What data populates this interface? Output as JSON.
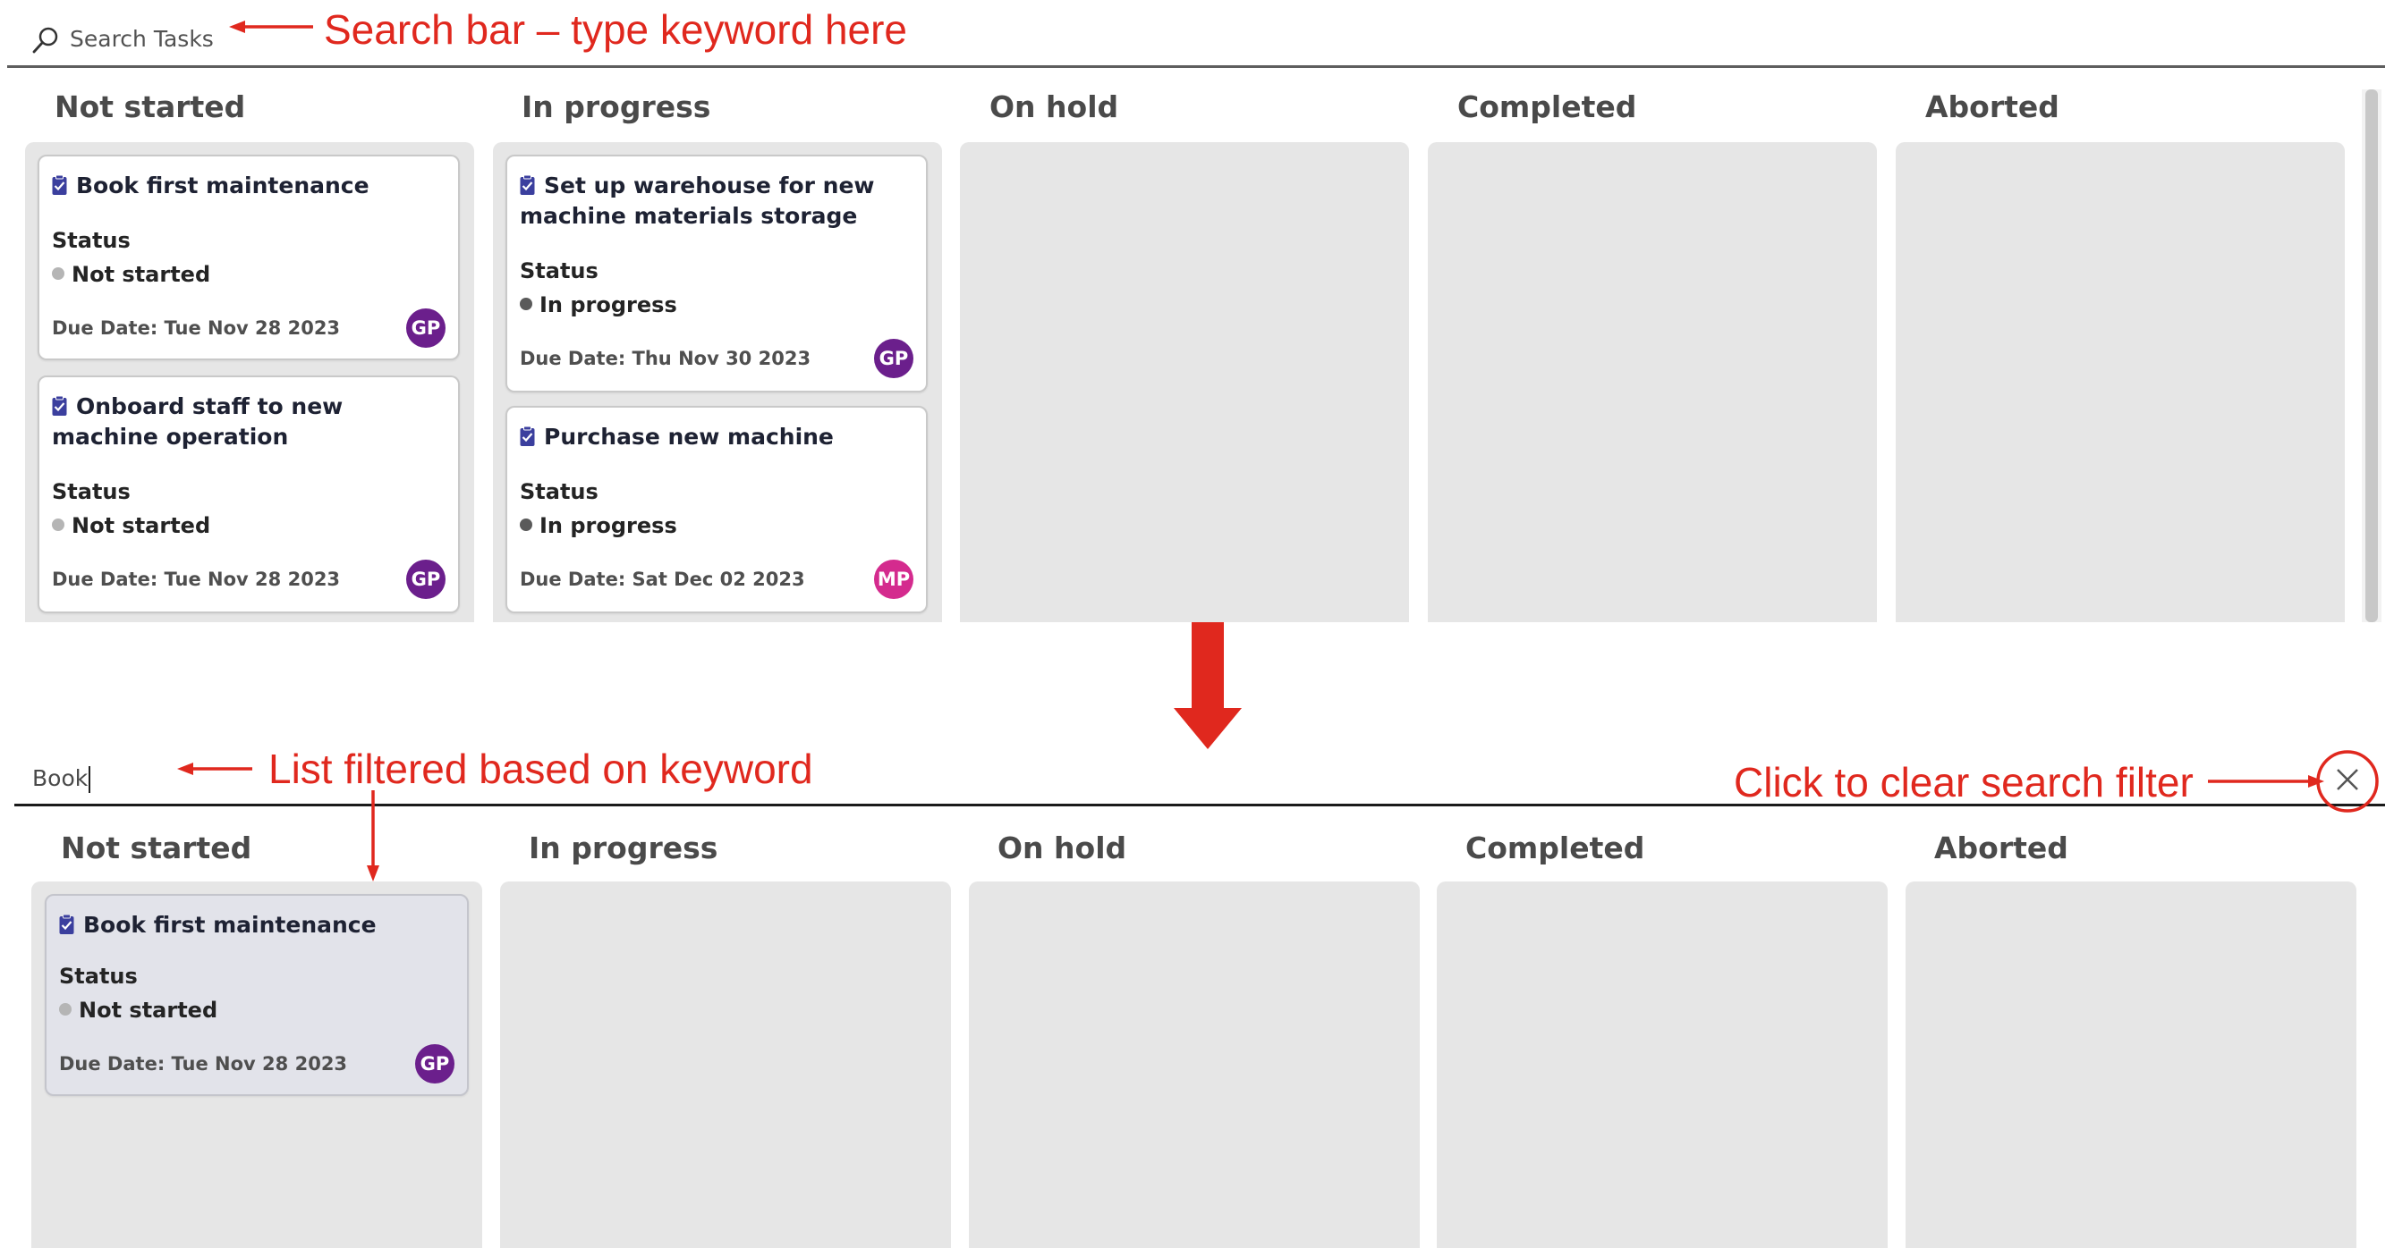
{
  "annotations": {
    "search_bar": "Search bar – type keyword here",
    "filtered": "List filtered based on keyword",
    "clear": "Click to clear search filter",
    "color": "#e0281e"
  },
  "top": {
    "search": {
      "placeholder": "Search Tasks",
      "icon": "search-icon"
    },
    "columns": [
      {
        "title": "Not started"
      },
      {
        "title": "In progress"
      },
      {
        "title": "On hold"
      },
      {
        "title": "Completed"
      },
      {
        "title": "Aborted"
      }
    ],
    "cards": [
      {
        "title": "Book first maintenance",
        "status_label": "Status",
        "status": "Not started",
        "due_label": "Due Date:",
        "due": "Tue Nov 28 2023",
        "assignee": "GP"
      },
      {
        "title": "Onboard staff to new machine operation",
        "status_label": "Status",
        "status": "Not started",
        "due_label": "Due Date:",
        "due": "Tue Nov 28 2023",
        "assignee": "GP"
      },
      {
        "title": "Set up warehouse for new machine materials storage",
        "status_label": "Status",
        "status": "In progress",
        "due_label": "Due Date:",
        "due": "Thu Nov 30 2023",
        "assignee": "GP"
      },
      {
        "title": "Purchase new machine",
        "status_label": "Status",
        "status": "In progress",
        "due_label": "Due Date:",
        "due": "Sat Dec 02 2023",
        "assignee": "MP"
      }
    ]
  },
  "bottom": {
    "search": {
      "value": "Book",
      "clear_icon": "close-icon"
    },
    "columns": [
      {
        "title": "Not started"
      },
      {
        "title": "In progress"
      },
      {
        "title": "On hold"
      },
      {
        "title": "Completed"
      },
      {
        "title": "Aborted"
      }
    ],
    "cards": [
      {
        "title": "Book first maintenance",
        "status_label": "Status",
        "status": "Not started",
        "due_label": "Due Date:",
        "due": "Tue Nov 28 2023",
        "assignee": "GP"
      }
    ]
  },
  "colors": {
    "avatar_gp": "#6b1f8c",
    "avatar_mp": "#d42b8e",
    "status_not_started": "#b5b5b5",
    "status_in_progress": "#5a5a5a",
    "task_icon": "#3b3f9e"
  }
}
